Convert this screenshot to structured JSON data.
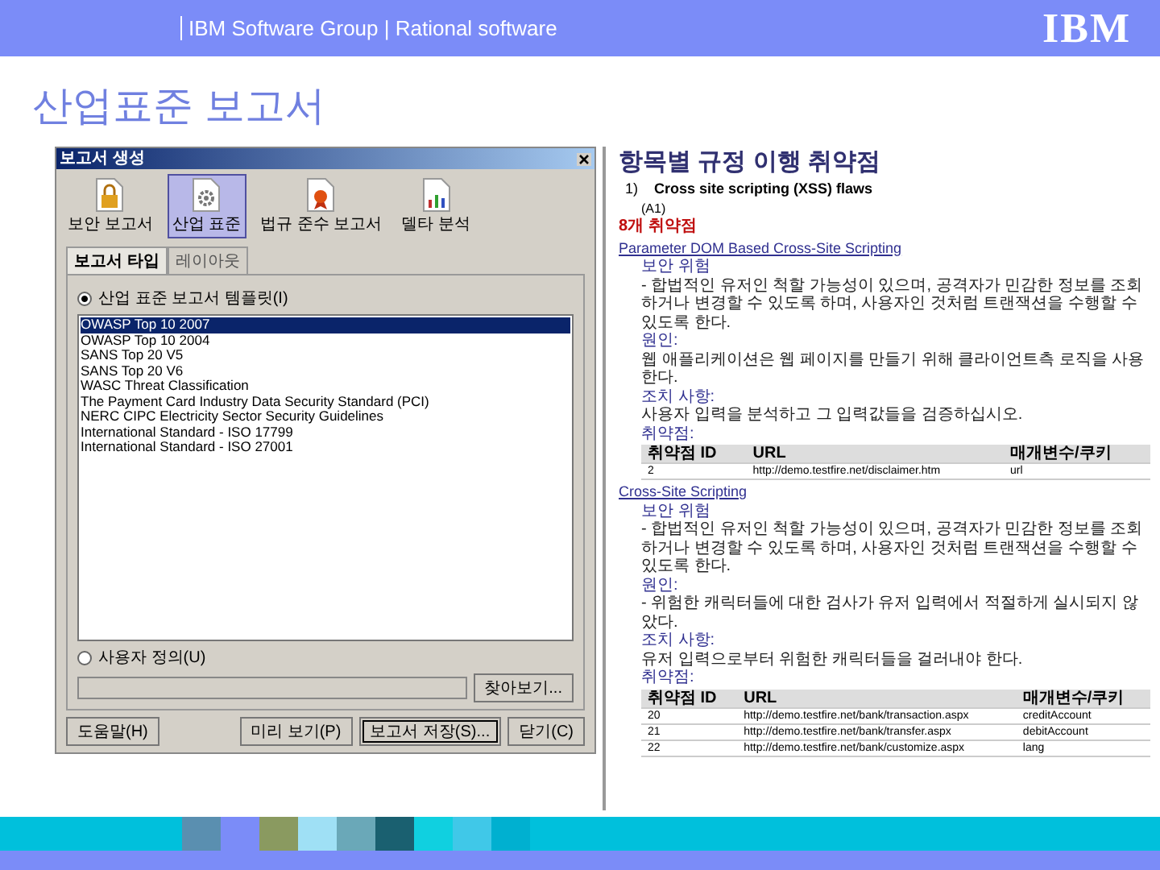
{
  "header": {
    "group": "IBM Software Group | Rational software",
    "logo": "IBM"
  },
  "title": "산업표준 보고서",
  "dialog": {
    "title": "보고서 생성",
    "toolbar": [
      {
        "label": "보안 보고서",
        "kind": "lock",
        "selected": false
      },
      {
        "label": "산업 표준",
        "kind": "gear",
        "selected": true
      },
      {
        "label": "법규 준수 보고서",
        "kind": "ribbon",
        "selected": false
      },
      {
        "label": "델타 분석",
        "kind": "chart",
        "selected": false
      }
    ],
    "tabs": [
      {
        "label": "보고서 타입",
        "selected": true
      },
      {
        "label": "레이아웃",
        "selected": false
      }
    ],
    "template_option": {
      "label": "산업 표준 보고서 템플릿(I)",
      "checked": true
    },
    "templates": [
      {
        "label": "OWASP Top 10 2007",
        "selected": true
      },
      {
        "label": "OWASP Top 10 2004",
        "selected": false
      },
      {
        "label": "SANS Top 20 V5",
        "selected": false
      },
      {
        "label": "SANS Top 20 V6",
        "selected": false
      },
      {
        "label": "WASC Threat Classification",
        "selected": false
      },
      {
        "label": "The Payment Card Industry Data Security Standard (PCI)",
        "selected": false
      },
      {
        "label": "NERC CIPC Electricity Sector Security Guidelines",
        "selected": false
      },
      {
        "label": "International Standard - ISO 17799",
        "selected": false
      },
      {
        "label": "International Standard - ISO 27001",
        "selected": false
      }
    ],
    "custom_option": {
      "label": "사용자 정의(U)",
      "checked": false
    },
    "browse_button": "찾아보기...",
    "help_button": "도움말(H)",
    "buttons": [
      {
        "label": "미리 보기(P)",
        "default": false
      },
      {
        "label": "보고서 저장(S)...",
        "default": true
      },
      {
        "label": "닫기(C)",
        "default": false
      }
    ]
  },
  "report": {
    "title": "항목별 규정 이행 취약점",
    "number": "1)",
    "heading": "Cross site scripting (XSS) flaws",
    "code": "(A1)",
    "count": "8개 취약점",
    "sections": [
      {
        "link": "Parameter DOM Based Cross-Site Scripting",
        "risk_heading": "보안 위험",
        "risk": "- 합법적인 유저인 척할 가능성이 있으며, 공격자가 민감한 정보를 조회하거나 변경할 수 있도록 하며, 사용자인 것처럼 트랜잭션을 수행할 수 있도록 한다.",
        "cause_heading": "원인:",
        "cause": "웹 애플리케이션은 웹 페이지를 만들기 위해 클라이언트측 로직을 사용한다.",
        "fix_heading": "조치 사항:",
        "fix": "사용자 입력을 분석하고 그 입력값들을 검증하십시오.",
        "vuln_heading": "취약점:",
        "columns": [
          "취약점 ID",
          "URL",
          "매개변수/쿠키"
        ],
        "rows": [
          [
            "2",
            "http://demo.testfire.net/disclaimer.htm",
            "url"
          ]
        ]
      },
      {
        "link": "Cross-Site Scripting",
        "risk_heading": "보안 위험",
        "risk": "- 합법적인 유저인 척할 가능성이 있으며, 공격자가 민감한 정보를 조회하거나 변경할 수 있도록 하며, 사용자인 것처럼 트랜잭션을 수행할 수 있도록 한다.",
        "cause_heading": "원인:",
        "cause": "- 위험한 캐릭터들에 대한 검사가 유저 입력에서 적절하게 실시되지 않았다.",
        "fix_heading": "조치 사항:",
        "fix": "유저 입력으로부터 위험한 캐릭터들을 걸러내야 한다.",
        "vuln_heading": "취약점:",
        "columns": [
          "취약점 ID",
          "URL",
          "매개변수/쿠키"
        ],
        "rows": [
          [
            "20",
            "http://demo.testfire.net/bank/transaction.aspx",
            "creditAccount"
          ],
          [
            "21",
            "http://demo.testfire.net/bank/transfer.aspx",
            "debitAccount"
          ],
          [
            "22",
            "http://demo.testfire.net/bank/customize.aspx",
            "lang"
          ]
        ]
      }
    ]
  }
}
